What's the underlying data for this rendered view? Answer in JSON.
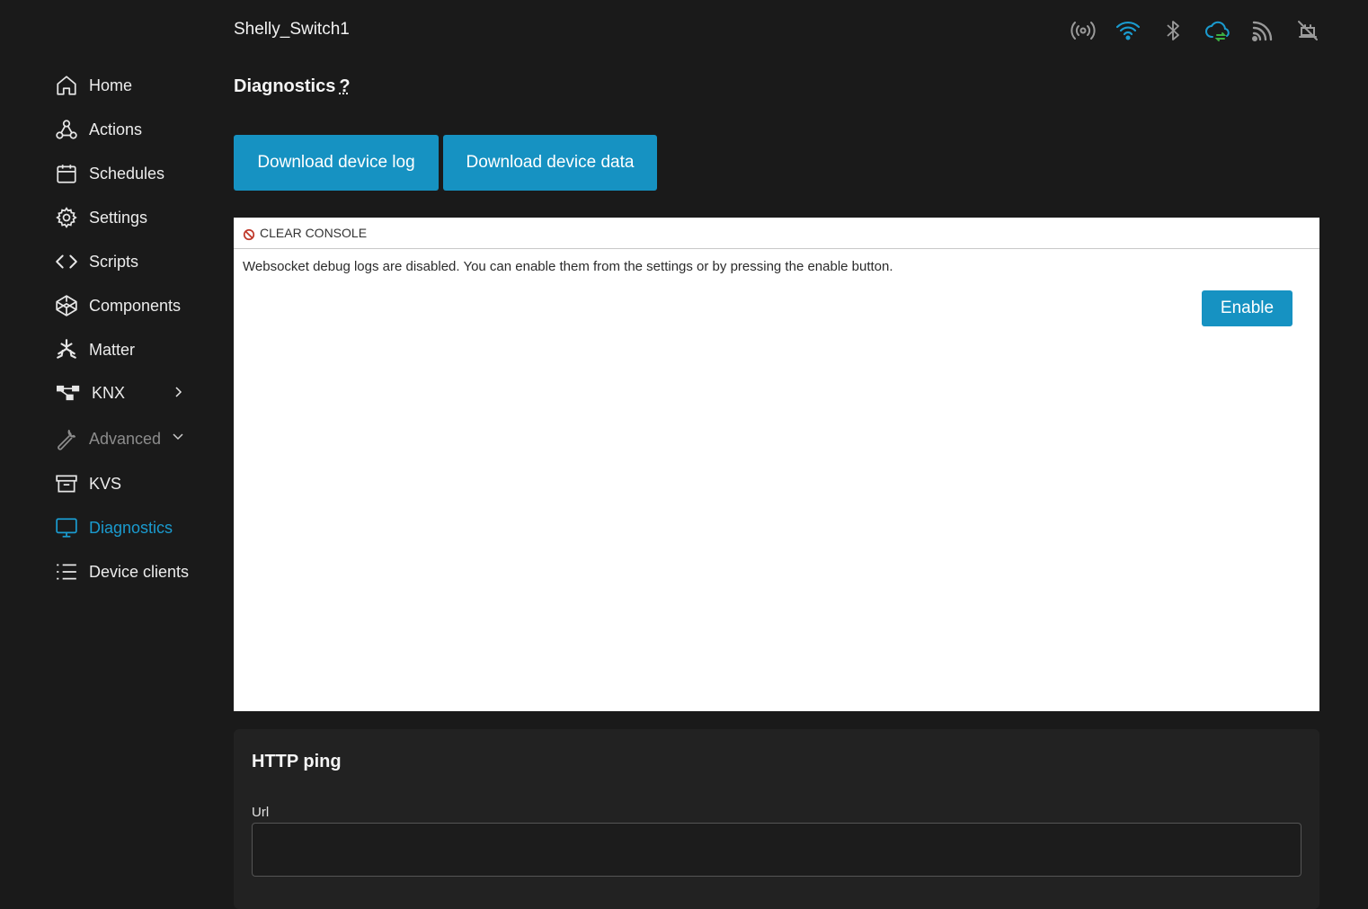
{
  "device": {
    "name": "Shelly_Switch1"
  },
  "status_icons": [
    "broadcast-icon",
    "wifi-icon",
    "bluetooth-icon",
    "cloud-sync-icon",
    "rss-icon",
    "disabled-connection-icon"
  ],
  "colors": {
    "accent": "#1692c2",
    "active_nav": "#1a9bcf",
    "background": "#1a1a1a",
    "console_bg": "#ffffff",
    "clear_icon": "#c0392b"
  },
  "sidebar": {
    "items": [
      {
        "label": "Home",
        "icon": "home-icon"
      },
      {
        "label": "Actions",
        "icon": "webhook-icon"
      },
      {
        "label": "Schedules",
        "icon": "calendar-icon"
      },
      {
        "label": "Settings",
        "icon": "gear-icon"
      },
      {
        "label": "Scripts",
        "icon": "code-icon"
      },
      {
        "label": "Components",
        "icon": "cube-icon"
      },
      {
        "label": "Matter",
        "icon": "matter-icon"
      },
      {
        "label": "KNX",
        "icon": "knx-icon"
      },
      {
        "label": "Advanced",
        "icon": "wrench-icon"
      },
      {
        "label": "KVS",
        "icon": "archive-icon"
      },
      {
        "label": "Diagnostics",
        "icon": "monitor-icon"
      },
      {
        "label": "Device clients",
        "icon": "list-icon"
      }
    ]
  },
  "page": {
    "title": "Diagnostics",
    "help": "?",
    "download_log_label": "Download device log",
    "download_data_label": "Download device data"
  },
  "console": {
    "clear_label": "CLEAR CONSOLE",
    "message": "Websocket debug logs are disabled. You can enable them from the settings or by pressing the enable button.",
    "enable_label": "Enable"
  },
  "http_ping": {
    "title": "HTTP ping",
    "url_label": "Url",
    "url_value": "",
    "url_placeholder": ""
  }
}
